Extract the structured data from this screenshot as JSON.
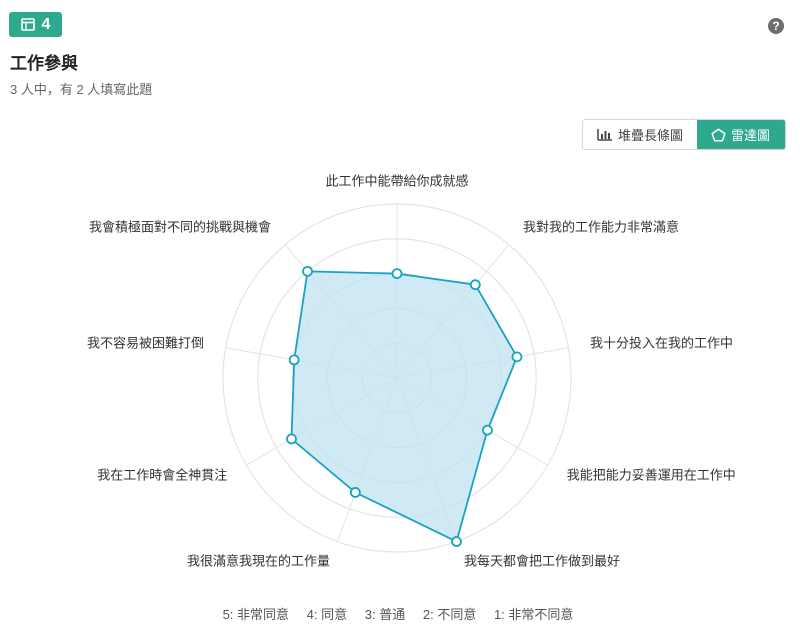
{
  "header": {
    "badge_number": "4",
    "badge_icon": "table-icon",
    "help_icon": "question-circle-icon",
    "help_glyph": "?",
    "title": "工作參與",
    "subtitle": "3 人中，有 2 人填寫此題"
  },
  "view_toggle": {
    "options": [
      {
        "label": "堆疊長條圖",
        "icon": "bar-chart-icon",
        "active": false
      },
      {
        "label": "雷達圖",
        "icon": "pentagon-icon",
        "active": true
      }
    ],
    "accent_color": "#2fa98d"
  },
  "legend": {
    "items": [
      "5: 非常同意",
      "4: 同意",
      "3: 普通",
      "2: 不同意",
      "1: 非常不同意"
    ]
  },
  "chart_data": {
    "type": "radar",
    "categories": [
      "此工作中能帶給你成就感",
      "我對我的工作能力非常滿意",
      "我十分投入在我的工作中",
      "我能把能力妥善運用在工作中",
      "我每天都會把工作做到最好",
      "我很滿意我現在的工作量",
      "我在工作時會全神貫注",
      "我不容易被困難打倒",
      "我會積極面對不同的挑戰與機會"
    ],
    "values": [
      3.0,
      3.5,
      3.5,
      3.0,
      5.0,
      3.5,
      3.5,
      3.0,
      4.0
    ],
    "rmin": 0,
    "rmax": 5,
    "rings": 5,
    "line_color": "#1aa3c0",
    "fill_color": "#bfe3f2",
    "grid_color": "#e4e4e4"
  }
}
